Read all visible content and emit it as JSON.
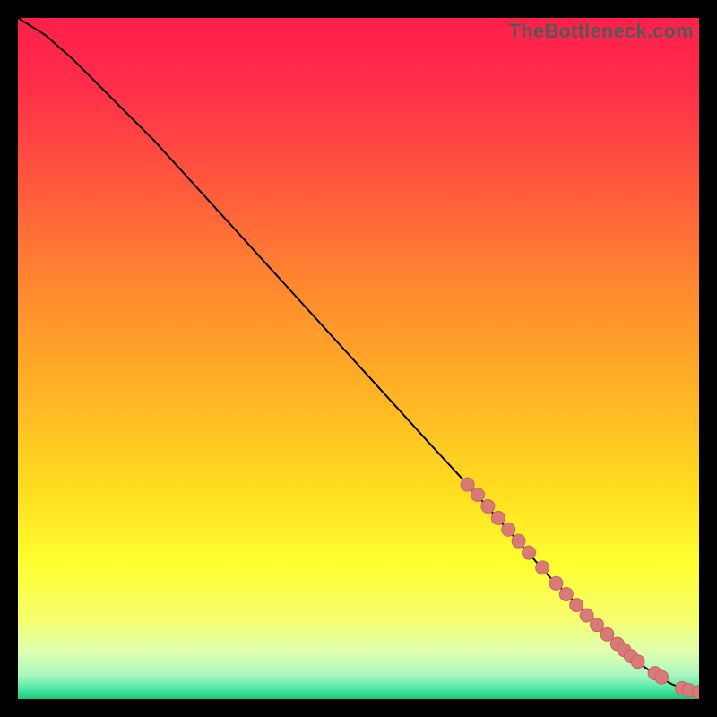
{
  "watermark": "TheBottleneck.com",
  "colors": {
    "gradient_stops": [
      {
        "offset": 0.0,
        "color": "#ff1f4a"
      },
      {
        "offset": 0.1,
        "color": "#ff2e49"
      },
      {
        "offset": 0.25,
        "color": "#ff5a3c"
      },
      {
        "offset": 0.4,
        "color": "#ff8a2f"
      },
      {
        "offset": 0.55,
        "color": "#ffb325"
      },
      {
        "offset": 0.7,
        "color": "#ffdf20"
      },
      {
        "offset": 0.8,
        "color": "#ffff30"
      },
      {
        "offset": 0.88,
        "color": "#f7ff6a"
      },
      {
        "offset": 0.93,
        "color": "#e0ffb0"
      },
      {
        "offset": 0.965,
        "color": "#a9f7c0"
      },
      {
        "offset": 0.985,
        "color": "#4fe8a6"
      },
      {
        "offset": 1.0,
        "color": "#18c978"
      }
    ],
    "line": "#000000",
    "marker_fill": "#d97a78",
    "marker_stroke": "#c96563"
  },
  "chart_data": {
    "type": "line",
    "title": "",
    "xlabel": "",
    "ylabel": "",
    "xlim": [
      0,
      100
    ],
    "ylim": [
      0,
      100
    ],
    "series": [
      {
        "name": "curve",
        "x": [
          0,
          4,
          8,
          12,
          16,
          20,
          30,
          40,
          50,
          60,
          66,
          70,
          74,
          78,
          82,
          85,
          88,
          90,
          92,
          94,
          96,
          98,
          100
        ],
        "y": [
          100,
          97.5,
          94,
          90,
          86,
          82,
          71,
          60,
          49,
          38,
          31.5,
          27,
          22.5,
          18,
          14,
          11,
          8,
          6.3,
          4.7,
          3.3,
          2.2,
          1.4,
          1.0
        ]
      }
    ],
    "markers": {
      "name": "highlighted-points",
      "x": [
        66,
        67.5,
        69,
        70.5,
        72,
        73.5,
        75,
        77,
        79,
        80.5,
        82,
        83.5,
        85,
        86.5,
        88,
        89,
        90,
        91,
        93.5,
        94.5,
        97.5,
        98.5,
        100
      ],
      "y": [
        31.5,
        30,
        28.3,
        26.6,
        24.9,
        23.2,
        21.5,
        19.3,
        17.0,
        15.4,
        13.8,
        12.3,
        10.9,
        9.5,
        8.1,
        7.2,
        6.3,
        5.5,
        3.8,
        3.2,
        1.6,
        1.3,
        1.0
      ]
    }
  }
}
